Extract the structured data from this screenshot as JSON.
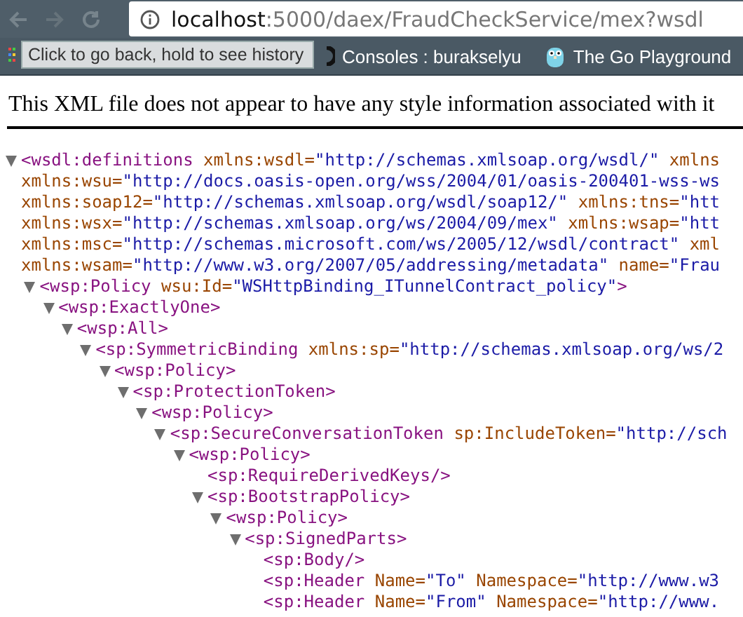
{
  "browser": {
    "url": {
      "host": "localhost",
      "path": ":5000/daex/FraudCheckService/mex?wsdl"
    },
    "bookmarks": [
      {
        "kind": "partial"
      },
      {
        "kind": "console",
        "label": "Consoles : burakselyu"
      },
      {
        "kind": "gopher",
        "label": "The Go Playground"
      }
    ],
    "tooltip": "Click to go back, hold to see history"
  },
  "banner": "This XML file does not appear to have any style information associated with it",
  "tree": [
    {
      "kind": "toggle",
      "expanded": true,
      "lines": [
        [
          {
            "kind": "tag",
            "text": "<wsdl:definitions"
          },
          {
            "kind": "attr",
            "text": " xmlns:wsdl="
          },
          {
            "kind": "value",
            "text": "\"http://schemas.xmlsoap.org/wsdl/\""
          },
          {
            "kind": "attr",
            "text": " xmlns"
          }
        ],
        [
          {
            "kind": "attr",
            "text": "xmlns:wsu="
          },
          {
            "kind": "value",
            "text": "\"http://docs.oasis-open.org/wss/2004/01/oasis-200401-wss-ws"
          }
        ],
        [
          {
            "kind": "attr",
            "text": "xmlns:soap12="
          },
          {
            "kind": "value",
            "text": "\"http://schemas.xmlsoap.org/wsdl/soap12/\""
          },
          {
            "kind": "attr",
            "text": " xmlns:tns="
          },
          {
            "kind": "value",
            "text": "\"htt"
          }
        ],
        [
          {
            "kind": "attr",
            "text": "xmlns:wsx="
          },
          {
            "kind": "value",
            "text": "\"http://schemas.xmlsoap.org/ws/2004/09/mex\""
          },
          {
            "kind": "attr",
            "text": " xmlns:wsap="
          },
          {
            "kind": "value",
            "text": "\"htt"
          }
        ],
        [
          {
            "kind": "attr",
            "text": "xmlns:msc="
          },
          {
            "kind": "value",
            "text": "\"http://schemas.microsoft.com/ws/2005/12/wsdl/contract\""
          },
          {
            "kind": "attr",
            "text": " xml"
          }
        ],
        [
          {
            "kind": "attr",
            "text": "xmlns:wsam="
          },
          {
            "kind": "value",
            "text": "\"http://www.w3.org/2007/05/addressing/metadata\""
          },
          {
            "kind": "attr",
            "text": " name="
          },
          {
            "kind": "value",
            "text": "\"Frau"
          }
        ]
      ],
      "children": [
        {
          "kind": "toggle",
          "expanded": true,
          "lines": [
            [
              {
                "kind": "tag",
                "text": "<wsp:Policy"
              },
              {
                "kind": "attr",
                "text": " wsu:Id="
              },
              {
                "kind": "value",
                "text": "\"WSHttpBinding_ITunnelContract_policy\""
              },
              {
                "kind": "tag",
                "text": ">"
              }
            ]
          ],
          "children": [
            {
              "kind": "toggle",
              "expanded": true,
              "lines": [
                [
                  {
                    "kind": "tag",
                    "text": "<wsp:ExactlyOne>"
                  }
                ]
              ],
              "children": [
                {
                  "kind": "toggle",
                  "expanded": true,
                  "lines": [
                    [
                      {
                        "kind": "tag",
                        "text": "<wsp:All>"
                      }
                    ]
                  ],
                  "children": [
                    {
                      "kind": "toggle",
                      "expanded": true,
                      "lines": [
                        [
                          {
                            "kind": "tag",
                            "text": "<sp:SymmetricBinding"
                          },
                          {
                            "kind": "attr",
                            "text": " xmlns:sp="
                          },
                          {
                            "kind": "value",
                            "text": "\"http://schemas.xmlsoap.org/ws/2"
                          }
                        ]
                      ],
                      "children": [
                        {
                          "kind": "toggle",
                          "expanded": true,
                          "lines": [
                            [
                              {
                                "kind": "tag",
                                "text": "<wsp:Policy>"
                              }
                            ]
                          ],
                          "children": [
                            {
                              "kind": "toggle",
                              "expanded": true,
                              "lines": [
                                [
                                  {
                                    "kind": "tag",
                                    "text": "<sp:ProtectionToken>"
                                  }
                                ]
                              ],
                              "children": [
                                {
                                  "kind": "toggle",
                                  "expanded": true,
                                  "lines": [
                                    [
                                      {
                                        "kind": "tag",
                                        "text": "<wsp:Policy>"
                                      }
                                    ]
                                  ],
                                  "children": [
                                    {
                                      "kind": "toggle",
                                      "expanded": true,
                                      "lines": [
                                        [
                                          {
                                            "kind": "tag",
                                            "text": "<sp:SecureConversationToken"
                                          },
                                          {
                                            "kind": "attr",
                                            "text": " sp:IncludeToken="
                                          },
                                          {
                                            "kind": "value",
                                            "text": "\"http://sch"
                                          }
                                        ]
                                      ],
                                      "children": [
                                        {
                                          "kind": "toggle",
                                          "expanded": true,
                                          "lines": [
                                            [
                                              {
                                                "kind": "tag",
                                                "text": "<wsp:Policy>"
                                              }
                                            ]
                                          ],
                                          "children": [
                                            {
                                              "kind": "leaf",
                                              "lines": [
                                                [
                                                  {
                                                    "kind": "tag",
                                                    "text": "<sp:RequireDerivedKeys/>"
                                                  }
                                                ]
                                              ]
                                            },
                                            {
                                              "kind": "toggle",
                                              "expanded": true,
                                              "lines": [
                                                [
                                                  {
                                                    "kind": "tag",
                                                    "text": "<sp:BootstrapPolicy>"
                                                  }
                                                ]
                                              ],
                                              "children": [
                                                {
                                                  "kind": "toggle",
                                                  "expanded": true,
                                                  "lines": [
                                                    [
                                                      {
                                                        "kind": "tag",
                                                        "text": "<wsp:Policy>"
                                                      }
                                                    ]
                                                  ],
                                                  "children": [
                                                    {
                                                      "kind": "toggle",
                                                      "expanded": true,
                                                      "lines": [
                                                        [
                                                          {
                                                            "kind": "tag",
                                                            "text": "<sp:SignedParts>"
                                                          }
                                                        ]
                                                      ],
                                                      "children": [
                                                        {
                                                          "kind": "leaf",
                                                          "lines": [
                                                            [
                                                              {
                                                                "kind": "tag",
                                                                "text": "<sp:Body/>"
                                                              }
                                                            ]
                                                          ]
                                                        },
                                                        {
                                                          "kind": "leaf",
                                                          "lines": [
                                                            [
                                                              {
                                                                "kind": "tag",
                                                                "text": "<sp:Header"
                                                              },
                                                              {
                                                                "kind": "attr",
                                                                "text": " Name="
                                                              },
                                                              {
                                                                "kind": "value",
                                                                "text": "\"To\""
                                                              },
                                                              {
                                                                "kind": "attr",
                                                                "text": " Namespace="
                                                              },
                                                              {
                                                                "kind": "value",
                                                                "text": "\"http://www.w3"
                                                              }
                                                            ]
                                                          ]
                                                        },
                                                        {
                                                          "kind": "leaf",
                                                          "lines": [
                                                            [
                                                              {
                                                                "kind": "tag",
                                                                "text": "<sp:Header"
                                                              },
                                                              {
                                                                "kind": "attr",
                                                                "text": " Name="
                                                              },
                                                              {
                                                                "kind": "value",
                                                                "text": "\"From\""
                                                              },
                                                              {
                                                                "kind": "attr",
                                                                "text": " Namespace="
                                                              },
                                                              {
                                                                "kind": "value",
                                                                "text": "\"http://www."
                                                              }
                                                            ]
                                                          ]
                                                        }
                                                      ]
                                                    }
                                                  ]
                                                }
                                              ]
                                            }
                                          ]
                                        }
                                      ]
                                    }
                                  ]
                                }
                              ]
                            }
                          ]
                        }
                      ]
                    }
                  ]
                }
              ]
            }
          ]
        }
      ]
    }
  ]
}
